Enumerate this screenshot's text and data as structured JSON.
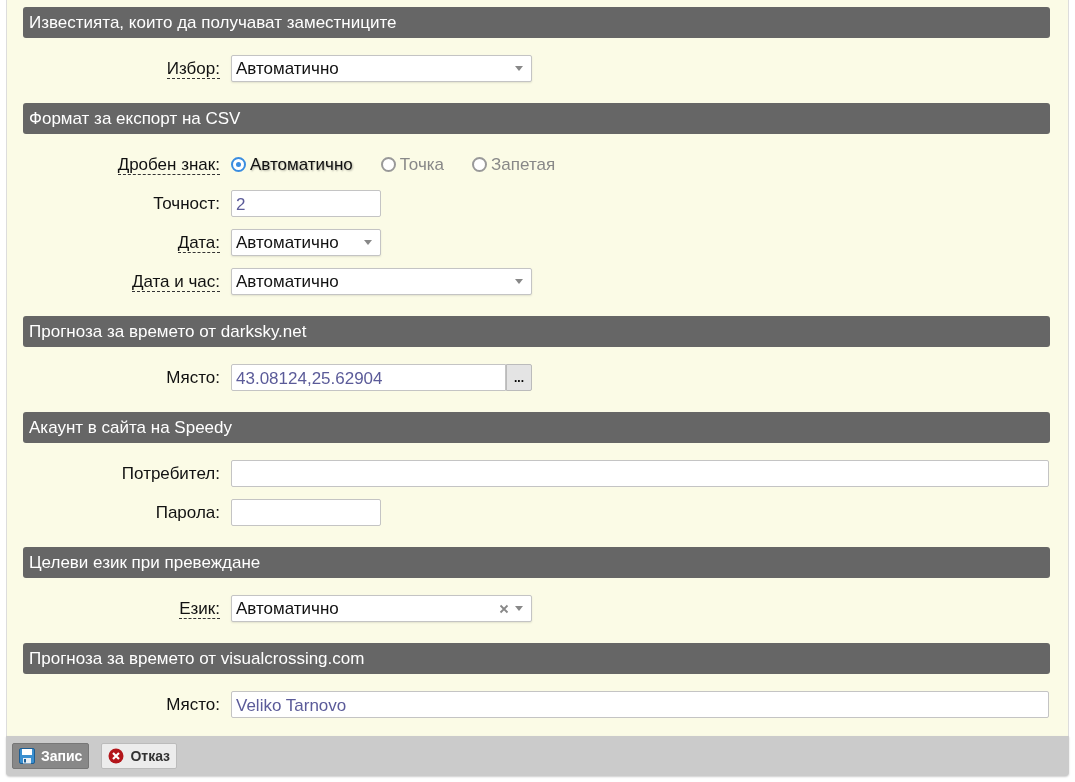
{
  "sections": [
    {
      "title": "Известията, които да получават заместниците",
      "fields": [
        {
          "kind": "select",
          "label": "Избор:",
          "hint": true,
          "value": "Автоматично",
          "clearable": false
        }
      ]
    },
    {
      "title": "Формат за експорт на CSV",
      "fields": [
        {
          "kind": "radio",
          "label": "Дробен знак:",
          "hint": true,
          "options": [
            {
              "label": "Автоматично",
              "selected": true
            },
            {
              "label": "Точка",
              "selected": false
            },
            {
              "label": "Запетая",
              "selected": false
            }
          ]
        },
        {
          "kind": "text",
          "label": "Точност:",
          "hint": false,
          "value": "2"
        },
        {
          "kind": "select",
          "label": "Дата:",
          "hint": true,
          "value": "Автоматично",
          "clearable": false
        },
        {
          "kind": "select",
          "label": "Дата и час:",
          "hint": true,
          "value": "Автоматично",
          "clearable": false
        }
      ]
    },
    {
      "title": "Прогноза за времето от darksky.net",
      "fields": [
        {
          "kind": "picker",
          "label": "Място:",
          "hint": false,
          "value": "43.08124,25.62904",
          "button": "..."
        }
      ]
    },
    {
      "title": "Акаунт в сайта на Speedy",
      "fields": [
        {
          "kind": "text",
          "label": "Потребител:",
          "hint": false
        },
        {
          "kind": "password",
          "label": "Парола:",
          "hint": false
        }
      ]
    },
    {
      "title": "Целеви език при превеждане",
      "fields": [
        {
          "kind": "select",
          "label": "Език:",
          "hint": true,
          "value": "Автоматично",
          "clearable": true
        }
      ]
    },
    {
      "title": "Прогноза за времето от visualcrossing.com",
      "fields": [
        {
          "kind": "text",
          "label": "Място:",
          "hint": false,
          "value": "Veliko Tarnovo"
        }
      ]
    }
  ],
  "buttons": [
    {
      "kind": "save",
      "label": "Запис",
      "primary": true
    },
    {
      "kind": "cancel",
      "label": "Отказ",
      "primary": false
    }
  ]
}
